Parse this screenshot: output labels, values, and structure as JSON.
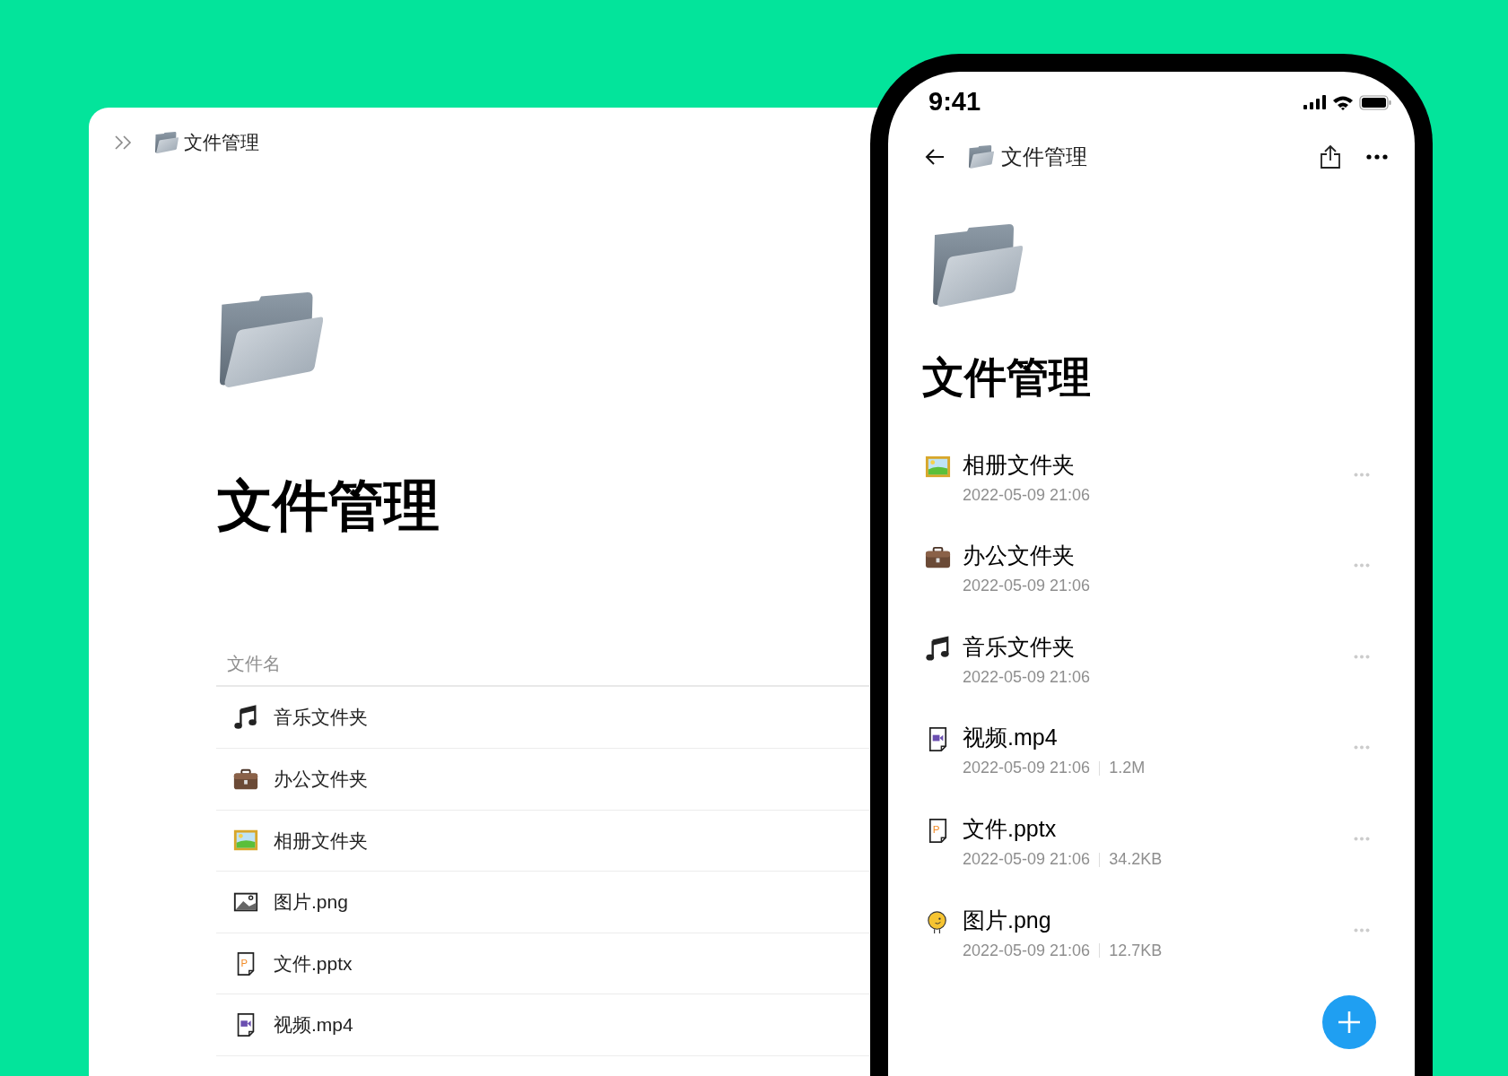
{
  "desktop": {
    "breadcrumb": "文件管理",
    "title": "文件管理",
    "column_header": "文件名",
    "files": [
      {
        "name": "音乐文件夹",
        "kind": "music"
      },
      {
        "name": "办公文件夹",
        "kind": "briefcase"
      },
      {
        "name": "相册文件夹",
        "kind": "framed-picture"
      },
      {
        "name": "图片.png",
        "kind": "image"
      },
      {
        "name": "文件.pptx",
        "kind": "pptx",
        "icon_letter": "P"
      },
      {
        "name": "视频.mp4",
        "kind": "video"
      }
    ]
  },
  "phone": {
    "time": "9:41",
    "nav_title": "文件管理",
    "title": "文件管理",
    "files": [
      {
        "name": "相册文件夹",
        "kind": "framed-picture",
        "date": "2022-05-09 21:06"
      },
      {
        "name": "办公文件夹",
        "kind": "briefcase",
        "date": "2022-05-09 21:06"
      },
      {
        "name": "音乐文件夹",
        "kind": "music",
        "date": "2022-05-09 21:06"
      },
      {
        "name": "视频.mp4",
        "kind": "video",
        "date": "2022-05-09 21:06",
        "size": "1.2M"
      },
      {
        "name": "文件.pptx",
        "kind": "pptx",
        "icon_letter": "P",
        "date": "2022-05-09 21:06",
        "size": "34.2KB"
      },
      {
        "name": "图片.png",
        "kind": "chick",
        "date": "2022-05-09 21:06",
        "size": "12.7KB"
      }
    ]
  }
}
